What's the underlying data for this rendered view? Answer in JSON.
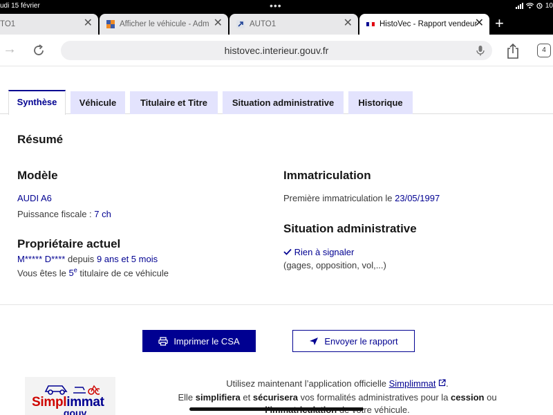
{
  "status": {
    "date": "udi 15 février",
    "time": "10"
  },
  "browser": {
    "tabs": [
      {
        "title": "TO1"
      },
      {
        "title": "Afficher le véhicule - Adm"
      },
      {
        "title": "AUTO1"
      },
      {
        "title": "HistoVec - Rapport vendeur"
      }
    ],
    "url": "histovec.interieur.gouv.fr",
    "tab_count": "4"
  },
  "page_tabs": [
    "Synthèse",
    "Véhicule",
    "Titulaire et Titre",
    "Situation administrative",
    "Historique"
  ],
  "resume": {
    "title": "Résumé",
    "model_heading": "Modèle",
    "model": "AUDI A6",
    "puissance_label": "Puissance fiscale :",
    "puissance_value": "7 ch",
    "owner_heading": "Propriétaire actuel",
    "owner_name": "M***** D****",
    "owner_since_label": "depuis",
    "owner_duration": "9 ans et 5 mois",
    "rank_prefix": "Vous êtes le",
    "rank_value": "5",
    "rank_sup": "e",
    "rank_suffix": "titulaire de ce véhicule",
    "immat_heading": "Immatriculation",
    "immat_label": "Première immatriculation le",
    "immat_date": "23/05/1997",
    "admin_heading": "Situation administrative",
    "admin_status": "Rien à signaler",
    "admin_detail": "(gages, opposition, vol,...)"
  },
  "actions": {
    "print": "Imprimer le CSA",
    "send": "Envoyer le rapport"
  },
  "promo": {
    "logo_a": "Simpl",
    "logo_b": "immat",
    "logo_c": ".gouv",
    "line1_prefix": "Utilisez maintenant l’application officielle",
    "line1_link": "Simplimmat",
    "line1_suffix": ".",
    "line2_a": "Elle",
    "line2_b": "simplifiera",
    "line2_c": "et",
    "line2_d": "sécurisera",
    "line2_e": "vos formalités administratives pour la",
    "line2_f": "cession",
    "line2_g": "ou",
    "line3_a": "l’immatriculation",
    "line3_b": "de votre véhicule."
  }
}
